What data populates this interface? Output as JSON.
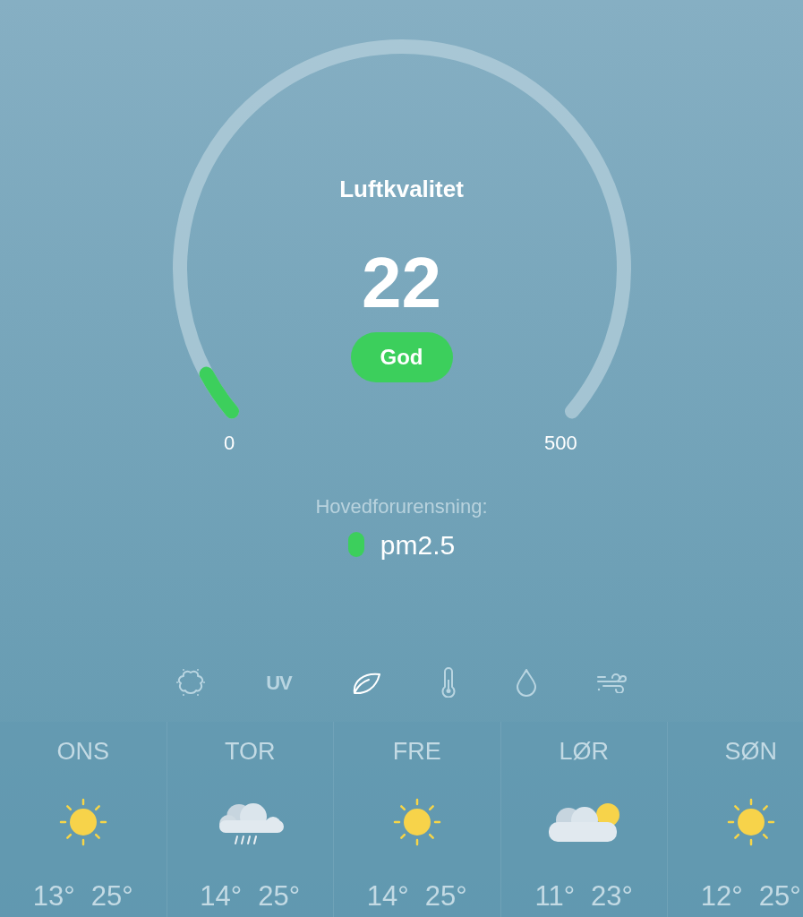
{
  "gauge": {
    "title": "Luftkvalitet",
    "value": "22",
    "status": "God",
    "color": "#3ccf5c",
    "min_label": "0",
    "max_label": "500"
  },
  "main_pollutant": {
    "label": "Hovedforurensning:",
    "value": "pm2.5",
    "color": "#3ccf5c"
  },
  "metric_tabs": [
    {
      "kind": "pollen",
      "selected": false
    },
    {
      "kind": "uv",
      "label": "UV",
      "selected": false
    },
    {
      "kind": "air",
      "selected": true
    },
    {
      "kind": "temperature",
      "selected": false
    },
    {
      "kind": "humidity",
      "selected": false
    },
    {
      "kind": "wind",
      "selected": false
    }
  ],
  "forecast": [
    {
      "day": "ONS",
      "kind": "sun",
      "low": "13°",
      "high": "25°"
    },
    {
      "day": "TOR",
      "kind": "rain",
      "low": "14°",
      "high": "25°"
    },
    {
      "day": "FRE",
      "kind": "sun",
      "low": "14°",
      "high": "25°"
    },
    {
      "day": "LØR",
      "kind": "partly_cloudy",
      "low": "11°",
      "high": "23°"
    },
    {
      "day": "SØN",
      "kind": "sun",
      "low": "12°",
      "high": "25°"
    }
  ]
}
